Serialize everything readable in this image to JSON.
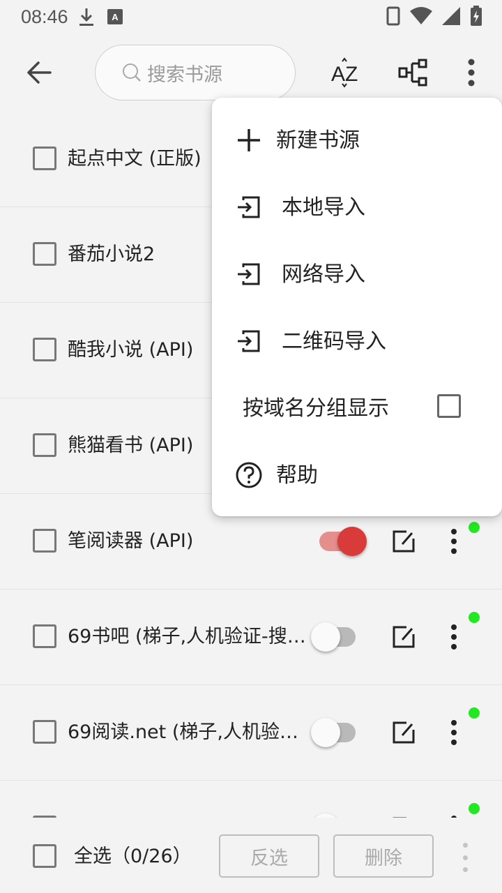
{
  "status_bar": {
    "time": "08:46",
    "icons": [
      "download-icon",
      "keyboard-a-icon",
      "phone-icon",
      "wifi-icon",
      "signal-icon",
      "battery-charging-icon"
    ]
  },
  "toolbar": {
    "back_icon": "arrow-left-icon",
    "search_placeholder": "搜索书源",
    "sort_icon": "sort-az-icon",
    "group_icon": "group-icon",
    "more_icon": "more-vertical-icon"
  },
  "sources": [
    {
      "name": "起点中文 (正版)",
      "enabled": true,
      "checked": false
    },
    {
      "name": "番茄小说2",
      "enabled": true,
      "checked": false
    },
    {
      "name": "酷我小说 (API)",
      "enabled": true,
      "checked": false
    },
    {
      "name": "熊猫看书 (API)",
      "enabled": true,
      "checked": false
    },
    {
      "name": "笔阅读器 (API)",
      "enabled": true,
      "checked": false
    },
    {
      "name": "69书吧 (梯子,人机验证-搜…",
      "enabled": false,
      "checked": false
    },
    {
      "name": "69阅读.net (梯子,人机验…",
      "enabled": false,
      "checked": false
    },
    {
      "name": "",
      "enabled": false,
      "checked": false
    }
  ],
  "bottom_bar": {
    "select_all": "全选（0/26）",
    "invert": "反选",
    "delete": "删除"
  },
  "menu": {
    "items": [
      {
        "label": "新建书源",
        "icon": "plus-icon"
      },
      {
        "label": "本地导入",
        "icon": "import-icon"
      },
      {
        "label": "网络导入",
        "icon": "import-icon"
      },
      {
        "label": "二维码导入",
        "icon": "import-icon"
      },
      {
        "label": "按域名分组显示",
        "icon": "",
        "checkbox": false
      },
      {
        "label": "帮助",
        "icon": "help-circle-icon"
      }
    ]
  },
  "colors": {
    "switch_on_track": "#e58e8e",
    "switch_on_knob": "#d93a3a",
    "status_dot": "#22e822",
    "background": "#f3f3f3"
  }
}
